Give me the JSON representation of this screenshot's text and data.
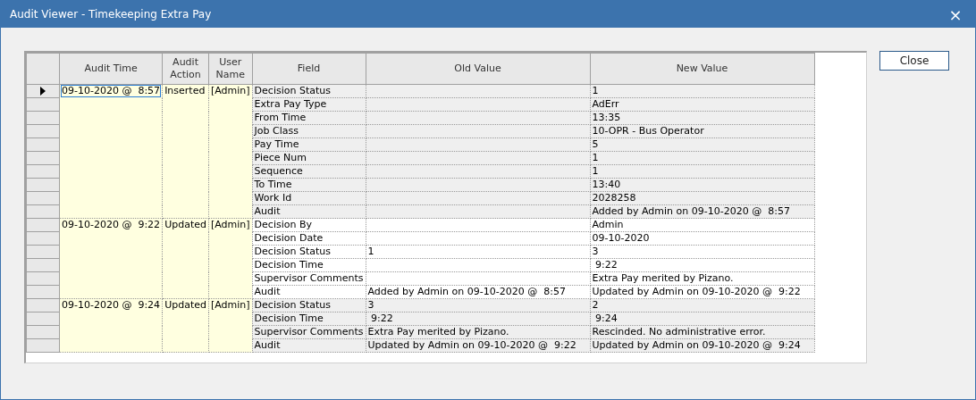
{
  "window": {
    "title": "Audit Viewer - Timekeeping Extra Pay",
    "close_glyph": "×"
  },
  "table": {
    "columns": [
      "Audit Time",
      "Audit Action",
      "User Name",
      "Field",
      "Old Value",
      "New Value"
    ],
    "groups": [
      {
        "audit_time": "09-10-2020 @  8:57",
        "audit_action": "Inserted",
        "user_name": "[Admin]",
        "selected": true,
        "rows": [
          {
            "field": "Decision Status",
            "old_value": "",
            "new_value": "1"
          },
          {
            "field": "Extra Pay Type",
            "old_value": "",
            "new_value": "AdErr"
          },
          {
            "field": "From Time",
            "old_value": "",
            "new_value": "13:35"
          },
          {
            "field": "Job Class",
            "old_value": "",
            "new_value": "10-OPR - Bus Operator"
          },
          {
            "field": "Pay Time",
            "old_value": "",
            "new_value": "5"
          },
          {
            "field": "Piece Num",
            "old_value": "",
            "new_value": "1"
          },
          {
            "field": "Sequence",
            "old_value": "",
            "new_value": "1"
          },
          {
            "field": "To Time",
            "old_value": "",
            "new_value": "13:40"
          },
          {
            "field": "Work Id",
            "old_value": "",
            "new_value": "2028258"
          },
          {
            "field": "Audit",
            "old_value": "",
            "new_value": "Added by Admin on 09-10-2020 @  8:57"
          }
        ]
      },
      {
        "audit_time": "09-10-2020 @  9:22",
        "audit_action": "Updated",
        "user_name": "[Admin]",
        "selected": false,
        "rows": [
          {
            "field": "Decision By",
            "old_value": "",
            "new_value": "Admin"
          },
          {
            "field": "Decision Date",
            "old_value": "",
            "new_value": "09-10-2020"
          },
          {
            "field": "Decision Status",
            "old_value": "1",
            "new_value": "3"
          },
          {
            "field": "Decision Time",
            "old_value": "",
            "new_value": " 9:22"
          },
          {
            "field": "Supervisor Comments",
            "old_value": "",
            "new_value": "Extra Pay merited by Pizano."
          },
          {
            "field": "Audit",
            "old_value": "Added by Admin on 09-10-2020 @  8:57",
            "new_value": "Updated by Admin on 09-10-2020 @  9:22"
          }
        ]
      },
      {
        "audit_time": "09-10-2020 @  9:24",
        "audit_action": "Updated",
        "user_name": "[Admin]",
        "selected": false,
        "rows": [
          {
            "field": "Decision Status",
            "old_value": "3",
            "new_value": "2"
          },
          {
            "field": "Decision Time",
            "old_value": " 9:22",
            "new_value": " 9:24"
          },
          {
            "field": "Supervisor Comments",
            "old_value": "Extra Pay merited by Pizano.",
            "new_value": "Rescinded. No administrative error."
          },
          {
            "field": "Audit",
            "old_value": "Updated by Admin on 09-10-2020 @  9:22",
            "new_value": "Updated by Admin on 09-10-2020 @  9:24"
          }
        ]
      }
    ]
  },
  "close_button": "Close"
}
